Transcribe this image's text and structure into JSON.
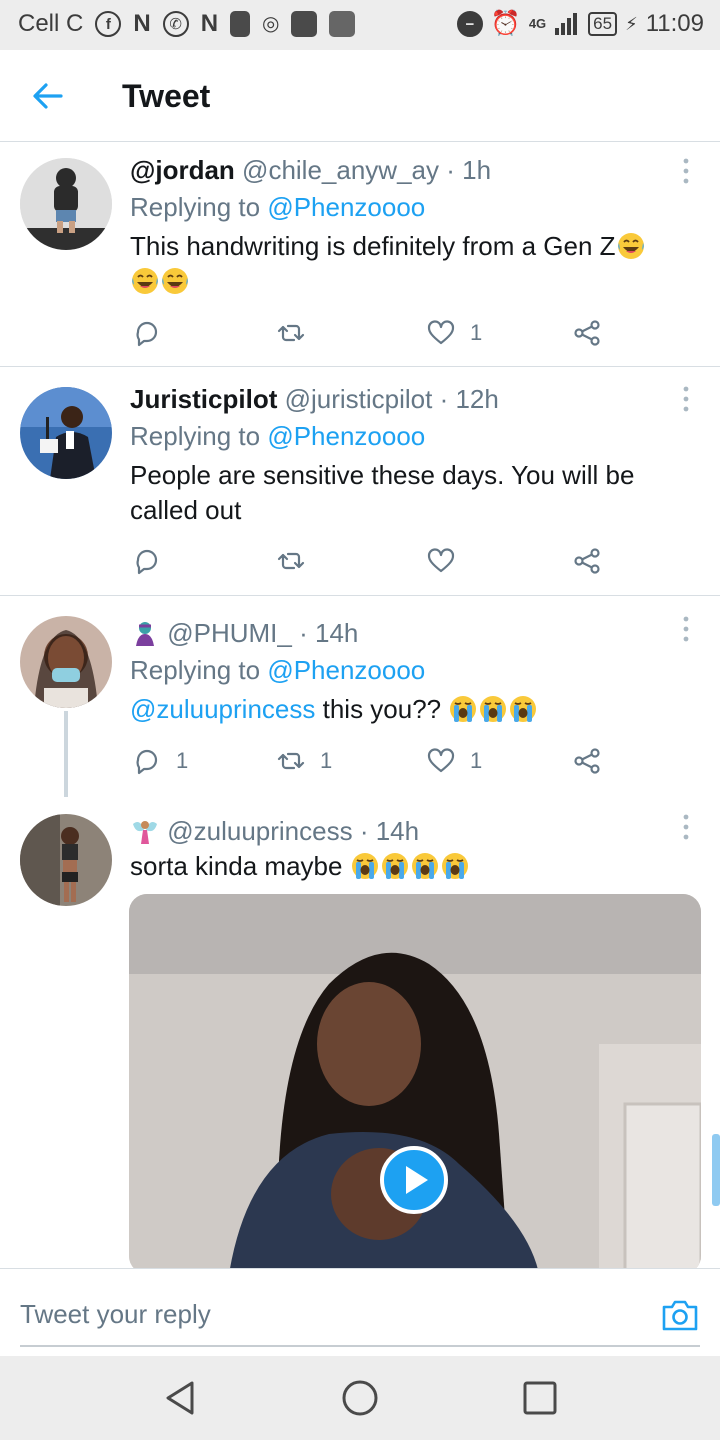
{
  "status_bar": {
    "carrier": "Cell C",
    "network": "4G",
    "battery": "65",
    "time": "11:09"
  },
  "header": {
    "title": "Tweet"
  },
  "tweets": [
    {
      "name": "@jordan",
      "handle": "@chile_anyw_ay",
      "time": "· 1h",
      "replying_prefix": "Replying to",
      "replying_to": "@Phenzoooo",
      "text": "This handwriting is definitely from a Gen Z",
      "emoji": "face-with-tears-of-joy",
      "emoji_count": 3,
      "replies": "",
      "retweets": "",
      "likes": "1"
    },
    {
      "name": "Juristicpilot",
      "handle": "@juristicpilot",
      "time": "· 12h",
      "replying_prefix": "Replying to",
      "replying_to": "@Phenzoooo",
      "text": "People are sensitive these days. You will be called out",
      "replies": "",
      "retweets": "",
      "likes": ""
    },
    {
      "name": "",
      "handle": "@PHUMI_",
      "time": "· 14h",
      "name_emoji": "genie",
      "replying_prefix": "Replying to",
      "replying_to": "@Phenzoooo",
      "mention": "@zuluuprincess",
      "text": "this you??",
      "emoji": "loudly-crying-face",
      "emoji_count": 3,
      "replies": "1",
      "retweets": "1",
      "likes": "1"
    },
    {
      "name": "",
      "handle": "@zuluuprincess",
      "time": "· 14h",
      "name_emoji": "fairy",
      "text": "sorta kinda maybe",
      "emoji": "loudly-crying-face",
      "emoji_count": 4,
      "media": "video"
    }
  ],
  "reply_bar": {
    "placeholder": "Tweet your reply"
  },
  "colors": {
    "accent": "#1da1f2",
    "text": "#14171a",
    "secondary": "#657786",
    "divider": "#d8dee3"
  }
}
